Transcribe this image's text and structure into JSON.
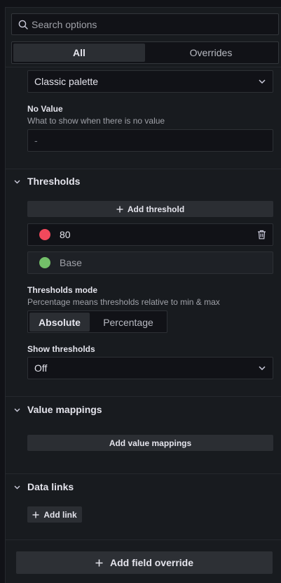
{
  "search": {
    "placeholder": "Search options"
  },
  "tabs": [
    {
      "label": "All",
      "active": true
    },
    {
      "label": "Overrides",
      "active": false
    }
  ],
  "color_scheme": {
    "value": "Classic palette"
  },
  "no_value": {
    "label": "No Value",
    "description": "What to show when there is no value",
    "placeholder": "-"
  },
  "thresholds": {
    "title": "Thresholds",
    "add_label": "Add threshold",
    "steps": [
      {
        "value": "80",
        "color": "#f2495c"
      },
      {
        "value": "Base",
        "color": "#73bf69"
      }
    ],
    "mode_label": "Thresholds mode",
    "mode_description": "Percentage means thresholds relative to min & max",
    "modes": [
      {
        "label": "Absolute",
        "active": true
      },
      {
        "label": "Percentage",
        "active": false
      }
    ],
    "show_label": "Show thresholds",
    "show_value": "Off"
  },
  "value_mappings": {
    "title": "Value mappings",
    "add_label": "Add value mappings"
  },
  "data_links": {
    "title": "Data links",
    "add_label": "Add link"
  },
  "footer": {
    "add_override_label": "Add field override"
  },
  "colors": {
    "red": "#f2495c",
    "green": "#73bf69",
    "panel": "#181b1f",
    "input": "#111217"
  }
}
